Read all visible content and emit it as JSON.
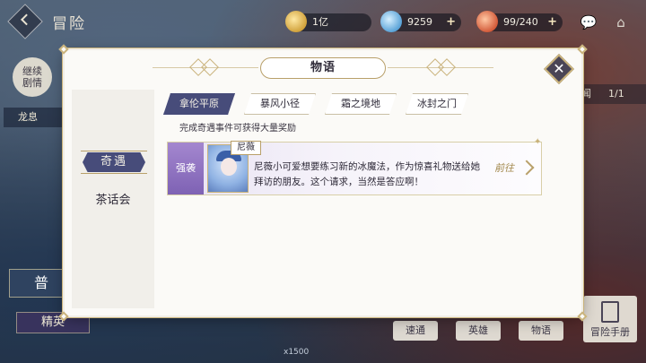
{
  "hud": {
    "title": "冒险",
    "resources": [
      {
        "name": "gold",
        "value": "1亿",
        "color": "#d1a23c"
      },
      {
        "name": "diamond",
        "value": "9259",
        "color": "#5aa3d8"
      },
      {
        "name": "stamina",
        "value": "99/240",
        "color": "#d35b3a"
      }
    ],
    "plus": "+"
  },
  "background": {
    "continue_story": "继续\n剧情",
    "dragon_tab": "龙息",
    "normal_button": "普",
    "elite_button": "精英",
    "right_tag_label": "闻",
    "right_tag_count": "1/1",
    "bottom_buttons": [
      "速通",
      "英雄",
      "物语"
    ],
    "manual_button": "冒险手册",
    "bottom_count": "x1500"
  },
  "modal": {
    "title": "物语",
    "close_symbol": "✕",
    "categories": {
      "active": "奇遇",
      "other": "茶话会"
    },
    "tabs": [
      {
        "label": "拿伦平原",
        "active": true
      },
      {
        "label": "暴风小径",
        "active": false
      },
      {
        "label": "霜之境地",
        "active": false
      },
      {
        "label": "冰封之门",
        "active": false
      }
    ],
    "hint": "完成奇遇事件可获得大量奖励",
    "event": {
      "badge": "强袭",
      "name": "尼薇",
      "description": "尼薇小可爱想要练习新的冰魔法，作为惊喜礼物送给她拜访的朋友。这个请求，当然是答应啊！",
      "go_label": "前往",
      "star": "✦"
    }
  },
  "colors": {
    "accent_indigo": "#474c7a",
    "gold_trim": "#c9b27a",
    "badge_purple": "#7e62b4"
  }
}
